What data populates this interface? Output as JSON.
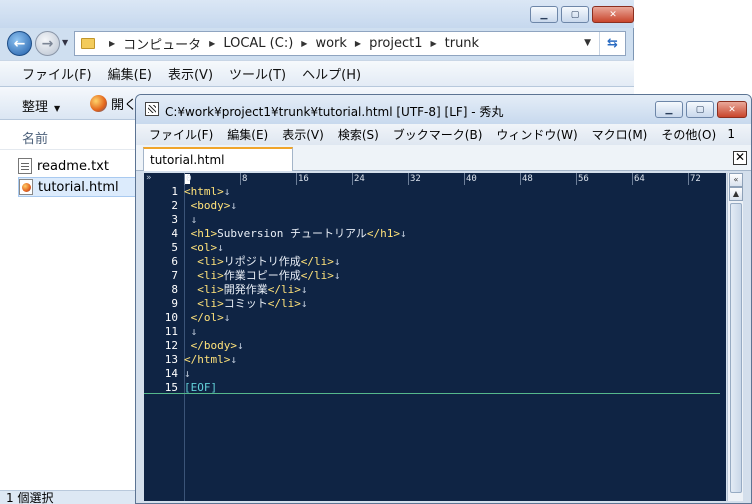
{
  "explorer": {
    "breadcrumbs": [
      "コンピュータ",
      "LOCAL (C:)",
      "work",
      "project1",
      "trunk"
    ],
    "menu": [
      "ファイル(F)",
      "編集(E)",
      "表示(V)",
      "ツール(T)",
      "ヘルプ(H)"
    ],
    "toolbar": {
      "organize": "整理",
      "open": "開く"
    },
    "column_name": "名前",
    "files": [
      {
        "name": "readme.txt",
        "icon": "text-file-icon"
      },
      {
        "name": "tutorial.html",
        "icon": "html-file-icon",
        "selected": true
      }
    ],
    "status": "1 個選択"
  },
  "editor": {
    "title": "C:¥work¥project1¥trunk¥tutorial.html  [UTF-8] [LF] - 秀丸",
    "menu": [
      "ファイル(F)",
      "編集(E)",
      "表示(V)",
      "検索(S)",
      "ブックマーク(B)",
      "ウィンドウ(W)",
      "マクロ(M)",
      "その他(O)"
    ],
    "menu_number": "1",
    "tab": "tutorial.html",
    "ruler": [
      "0",
      "8",
      "16",
      "24",
      "32",
      "40",
      "48",
      "56",
      "64",
      "72"
    ],
    "lines": [
      {
        "n": "1",
        "pre": "",
        "t1": "<html>",
        "mid": "",
        "t2": "",
        "eol": "↓"
      },
      {
        "n": "2",
        "pre": " ",
        "t1": "<body>",
        "mid": "",
        "t2": "",
        "eol": "↓"
      },
      {
        "n": "3",
        "pre": " ",
        "t1": "",
        "mid": "",
        "t2": "",
        "eol": "↓"
      },
      {
        "n": "4",
        "pre": " ",
        "t1": "<h1>",
        "mid": "Subversion チュートリアル",
        "t2": "</h1>",
        "eol": "↓"
      },
      {
        "n": "5",
        "pre": " ",
        "t1": "<ol>",
        "mid": "",
        "t2": "",
        "eol": "↓"
      },
      {
        "n": "6",
        "pre": "  ",
        "t1": "<li>",
        "mid": "リポジトリ作成",
        "t2": "</li>",
        "eol": "↓"
      },
      {
        "n": "7",
        "pre": "  ",
        "t1": "<li>",
        "mid": "作業コピー作成",
        "t2": "</li>",
        "eol": "↓"
      },
      {
        "n": "8",
        "pre": "  ",
        "t1": "<li>",
        "mid": "開発作業",
        "t2": "</li>",
        "eol": "↓"
      },
      {
        "n": "9",
        "pre": "  ",
        "t1": "<li>",
        "mid": "コミット",
        "t2": "</li>",
        "eol": "↓"
      },
      {
        "n": "10",
        "pre": " ",
        "t1": "</ol>",
        "mid": "",
        "t2": "",
        "eol": "↓"
      },
      {
        "n": "11",
        "pre": " ",
        "t1": "",
        "mid": "",
        "t2": "",
        "eol": "↓"
      },
      {
        "n": "12",
        "pre": " ",
        "t1": "</body>",
        "mid": "",
        "t2": "",
        "eol": "↓"
      },
      {
        "n": "13",
        "pre": "",
        "t1": "</html>",
        "mid": "",
        "t2": "",
        "eol": "↓"
      },
      {
        "n": "14",
        "pre": "",
        "t1": "",
        "mid": "",
        "t2": "",
        "eol": "↓"
      },
      {
        "n": "15",
        "pre": "",
        "t1": "",
        "mid": "",
        "t2": "",
        "eol": "",
        "eof": "[EOF]"
      }
    ]
  }
}
